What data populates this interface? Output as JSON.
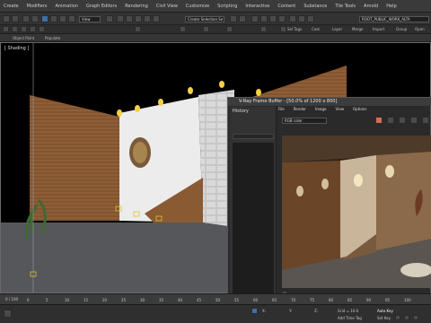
{
  "menu": [
    "Create",
    "Modifiers",
    "Animation",
    "Graph Editors",
    "Rendering",
    "Civil View",
    "Customize",
    "Scripting",
    "Interactive",
    "Content",
    "Substance",
    "Tile Tools",
    "Arnold",
    "Help"
  ],
  "workspace_label": "ROOT_PUBLIC_WORK_ALTA",
  "toolbar": {
    "view_dropdown": "View",
    "selection_set_placeholder": "Create Selection Se"
  },
  "ribbon": {
    "object_paint": "Object Paint",
    "populate": "Populate",
    "right_items": [
      "Sel Tags",
      "Layer",
      "Cast",
      "Merge",
      "Import",
      "Group",
      "Open"
    ]
  },
  "viewport": {
    "label": "[ Shading ]"
  },
  "vray": {
    "title": "V-Ray Frame Buffer - [50.0% of 1200 x 800]",
    "menu": [
      "File",
      "Render",
      "Image",
      "View",
      "Options"
    ],
    "history_label": "History",
    "channel_dropdown": "RGB color"
  },
  "timeline": {
    "frame_counter": "0 / 100",
    "ticks": [
      "0",
      "5",
      "10",
      "15",
      "20",
      "25",
      "30",
      "35",
      "40",
      "45",
      "50",
      "55",
      "60",
      "65",
      "70",
      "75",
      "80",
      "85",
      "90",
      "95",
      "100"
    ]
  },
  "status": {
    "x_label": "X:",
    "y_label": "Y:",
    "z_label": "Z:",
    "grid": "Grid = 10.0",
    "add_time_tag": "Add Time Tag",
    "auto_key": "Auto Key",
    "set_key": "Set Key"
  },
  "colors": {
    "wood": "#8a5a33",
    "wall_white": "#e8e8e8",
    "floor": "#55575a",
    "light_yellow": "#f3d046"
  }
}
